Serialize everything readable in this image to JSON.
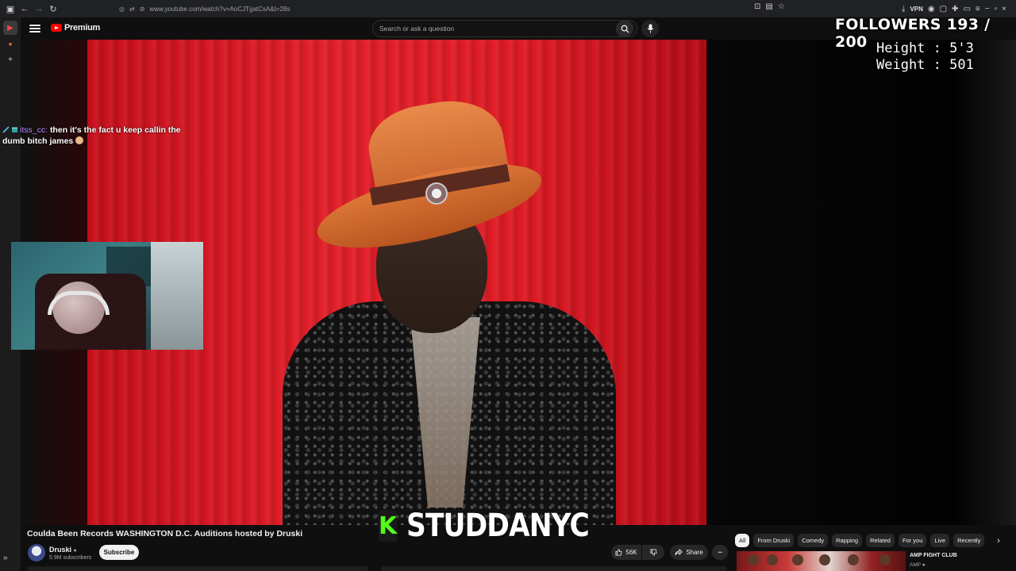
{
  "browser": {
    "url": "www.youtube.com/watch?v=AoCJTgatCsA&t=28s",
    "vpn_label": "VPN"
  },
  "youtube": {
    "logo_text": "Premium",
    "search_placeholder": "Search or ask a question"
  },
  "overlay": {
    "followers": "FOLLOWERS 193 / 200",
    "height_line": "Height : 5'3",
    "weight_line": "Weight : 501",
    "chat": {
      "user": "itss_cc:",
      "message": "then it's the fact u keep callin the dumb bitch james"
    },
    "kick_letter": "K",
    "streamer_name": "STUDDANYC"
  },
  "video": {
    "title": "Coulda Been Records WASHINGTON D.C. Auditions hosted by Druski",
    "channel": "Druski",
    "subscribers": "5.9M subscribers",
    "subscribe_label": "Subscribe",
    "likes": "56K",
    "share_label": "Share"
  },
  "chips": [
    "All",
    "From Druski",
    "Comedy",
    "Rapping",
    "Related",
    "For you",
    "Live",
    "Recently"
  ],
  "recommendation": {
    "title": "AMP FIGHT CLUB",
    "channel": "AMP"
  },
  "colors": {
    "brand_red": "#ff0000",
    "kick_green": "#53fc18",
    "chat_user": "#b78bff"
  }
}
